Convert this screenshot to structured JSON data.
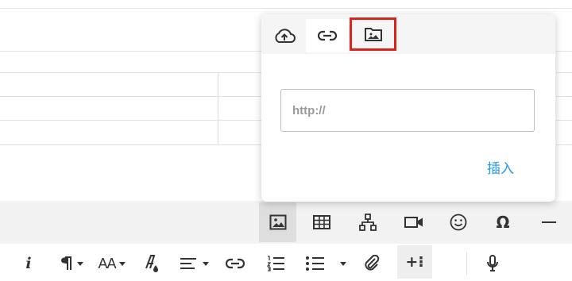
{
  "popup": {
    "tabs": [
      {
        "name": "upload",
        "icon": "cloud-upload-icon"
      },
      {
        "name": "by-url",
        "icon": "link-icon"
      },
      {
        "name": "manager",
        "icon": "image-folder-icon"
      }
    ],
    "url_placeholder": "http://",
    "url_value": "",
    "insert_label": "插入"
  },
  "toolbar": {
    "row1": [
      "image-icon",
      "table-icon",
      "hierarchy-icon",
      "video-icon",
      "emoji-icon",
      "omega-icon",
      "horizontal-line-icon"
    ],
    "row2": [
      "italic-icon",
      "paragraph-format-icon",
      "font-size-icon",
      "text-color-icon",
      "align-icon",
      "link-icon",
      "ordered-list-icon",
      "unordered-list-icon",
      "attachment-icon",
      "more-icon",
      "microphone-icon"
    ],
    "omega_label": "Ω",
    "italic_label": "i",
    "more_label": "+⁝",
    "font_size_label": "AA"
  },
  "colors": {
    "accent": "#2196f3",
    "highlight": "#d7271d",
    "toolbar_bg": "#f2f2f2"
  }
}
